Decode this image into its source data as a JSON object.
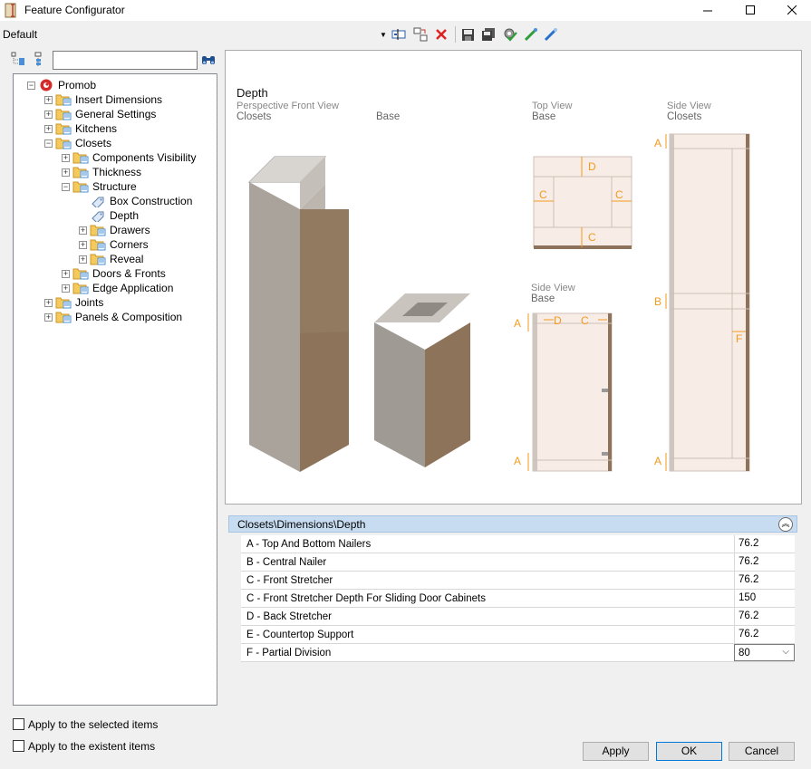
{
  "window": {
    "title": "Feature Configurator"
  },
  "toolbar": {
    "profile": "Default"
  },
  "search": {
    "placeholder": ""
  },
  "tree": [
    {
      "label": "Promob",
      "level": 0,
      "expanded": true,
      "icon": "promob-logo-icon"
    },
    {
      "label": "Insert Dimensions",
      "level": 1,
      "expanded": false,
      "icon": "folder-icon"
    },
    {
      "label": "General Settings",
      "level": 1,
      "expanded": false,
      "icon": "folder-icon"
    },
    {
      "label": "Kitchens",
      "level": 1,
      "expanded": false,
      "icon": "folder-icon"
    },
    {
      "label": "Closets",
      "level": 1,
      "expanded": true,
      "icon": "folder-open-icon"
    },
    {
      "label": "Components Visibility",
      "level": 2,
      "expanded": false,
      "icon": "folder-icon"
    },
    {
      "label": "Thickness",
      "level": 2,
      "expanded": false,
      "icon": "folder-icon"
    },
    {
      "label": "Structure",
      "level": 2,
      "expanded": true,
      "icon": "folder-open-icon"
    },
    {
      "label": "Box Construction",
      "level": 3,
      "leaf": true,
      "icon": "tag-icon"
    },
    {
      "label": "Depth",
      "level": 3,
      "leaf": true,
      "icon": "tag-icon",
      "selected": true
    },
    {
      "label": "Drawers",
      "level": 3,
      "expanded": false,
      "icon": "folder-icon"
    },
    {
      "label": "Corners",
      "level": 3,
      "expanded": false,
      "icon": "folder-icon"
    },
    {
      "label": "Reveal",
      "level": 3,
      "expanded": false,
      "icon": "folder-icon"
    },
    {
      "label": "Doors & Fronts",
      "level": 2,
      "expanded": false,
      "icon": "folder-icon"
    },
    {
      "label": "Edge Application",
      "level": 2,
      "expanded": false,
      "icon": "folder-icon"
    },
    {
      "label": "Joints",
      "level": 1,
      "expanded": false,
      "icon": "folder-icon"
    },
    {
      "label": "Panels & Composition",
      "level": 1,
      "expanded": false,
      "icon": "folder-icon"
    }
  ],
  "preview": {
    "title": "Depth",
    "perspective_caption": "Perspective Front View",
    "perspective_closets": "Closets",
    "perspective_base": "Base",
    "top_caption": "Top View",
    "top_sub": "Base",
    "side_caption": "Side View",
    "side_sub": "Closets",
    "side_base_caption": "Side View",
    "side_base_sub": "Base",
    "markers": {
      "a": "A",
      "b": "B",
      "c": "C",
      "d": "D",
      "f": "F"
    },
    "colors": {
      "dimension": "#f39a1e",
      "panel_grey": "#a9a39c",
      "wood": "#8c735a",
      "inner": "#f7ece6"
    }
  },
  "properties": {
    "path": "Closets\\Dimensions\\Depth",
    "rows": [
      {
        "name": "A - Top And Bottom Nailers",
        "value": "76.2"
      },
      {
        "name": "B - Central Nailer",
        "value": "76.2"
      },
      {
        "name": "C -  Front Stretcher",
        "value": "76.2"
      },
      {
        "name": "C - Front Stretcher Depth For Sliding Door Cabinets",
        "value": "150"
      },
      {
        "name": "D -  Back Stretcher",
        "value": "76.2"
      },
      {
        "name": "E - Countertop Support",
        "value": "76.2"
      },
      {
        "name": "F - Partial Division",
        "value": "80",
        "combo": true
      }
    ]
  },
  "footer": {
    "apply_selected": "Apply to the selected items",
    "apply_existent": "Apply to the existent items",
    "apply": "Apply",
    "ok": "OK",
    "cancel": "Cancel"
  }
}
